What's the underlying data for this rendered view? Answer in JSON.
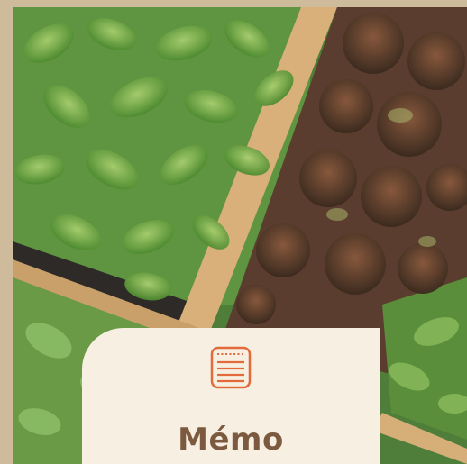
{
  "card": {
    "title": "Mémo",
    "icon": "notepad-icon"
  },
  "colors": {
    "card_background": "#f6efe2",
    "title": "#7b5a3f",
    "icon_accent": "#e26a3b"
  }
}
